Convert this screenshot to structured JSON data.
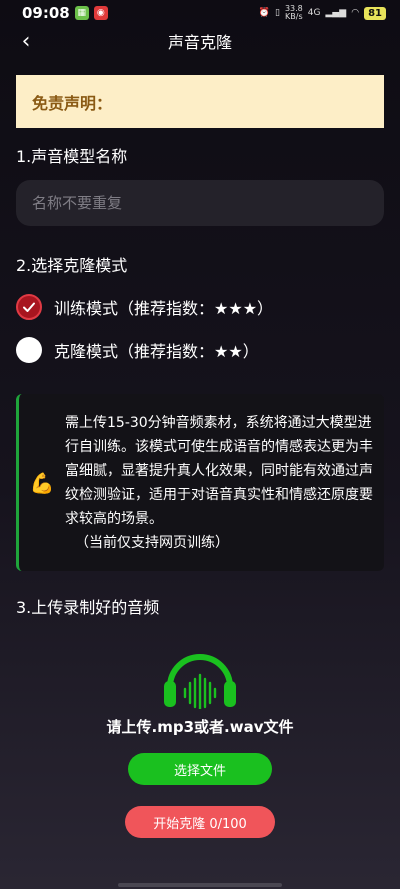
{
  "status_bar": {
    "time": "09:08",
    "net_speed_value": "33.8",
    "net_speed_unit": "KB/s",
    "signal": "4G",
    "battery": "81"
  },
  "header": {
    "back_icon": "‹",
    "title": "声音克隆"
  },
  "disclaimer": {
    "label": "免责声明："
  },
  "section1": {
    "title": "1.声音模型名称",
    "input_placeholder": "名称不要重复",
    "input_value": ""
  },
  "section2": {
    "title": "2.选择克隆模式",
    "options": [
      {
        "label": "训练模式（推荐指数：★★★）",
        "selected": true
      },
      {
        "label": "克隆模式（推荐指数：★★）",
        "selected": false
      }
    ],
    "card_icon": "💪",
    "card_text": "需上传15-30分钟音频素材，系统将通过大模型进行自训练。该模式可使生成语音的情感表达更为丰富细腻，显著提升真人化效果，同时能有效通过声纹检测验证，适用于对语音真实性和情感还原度要求较高的场景。",
    "card_note": "（当前仅支持网页训练）"
  },
  "section3": {
    "title": "3.上传录制好的音频",
    "upload_hint": "请上传.mp3或者.wav文件",
    "select_button": "选择文件",
    "start_button": "开始克隆 0/100"
  },
  "colors": {
    "accent_green": "#1ac01f",
    "accent_red": "#f0555a",
    "disclaimer_bg": "#fdeec7",
    "disclaimer_text": "#8a5a14"
  }
}
